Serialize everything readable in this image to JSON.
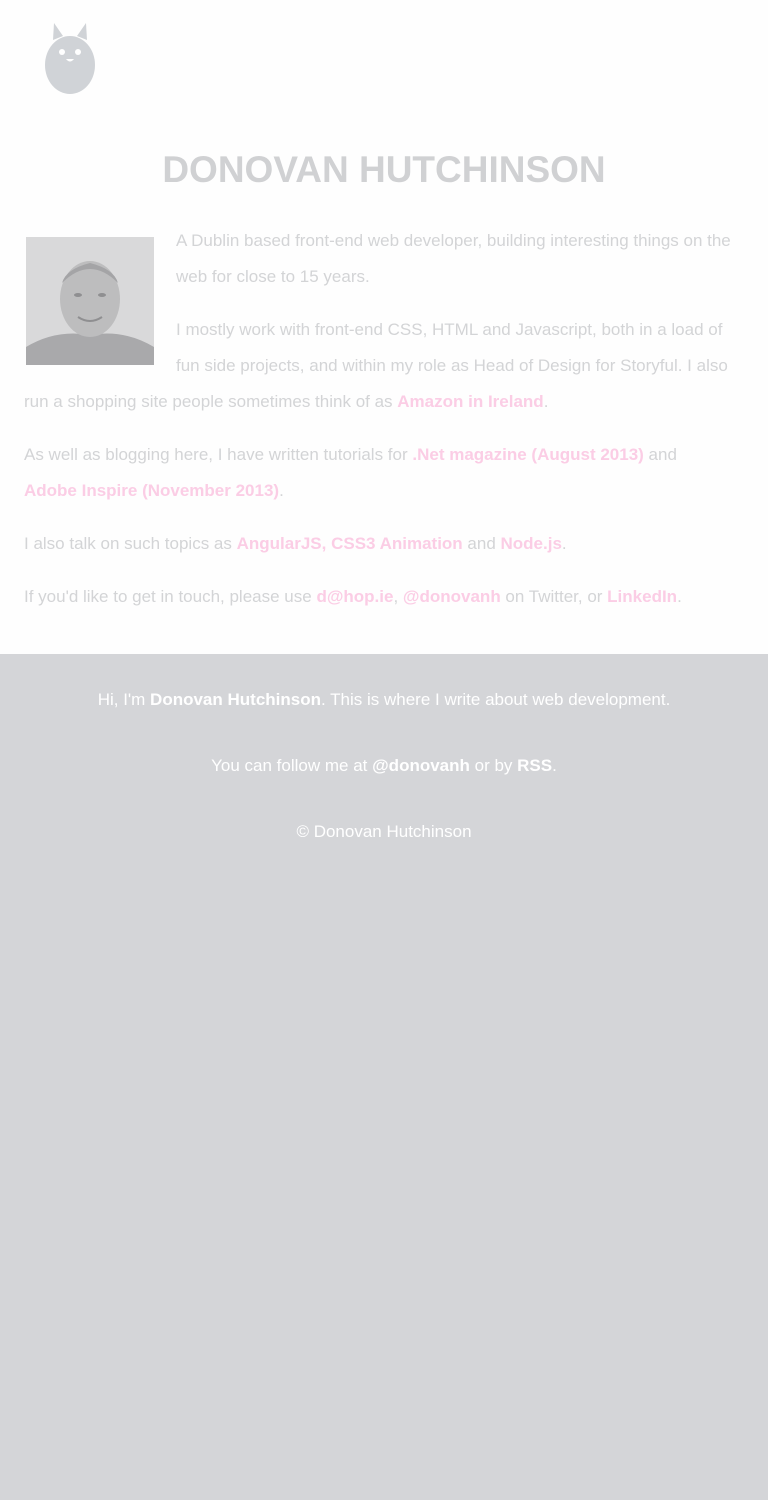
{
  "header": {
    "logo_icon": "rabbit-logo-icon",
    "title": "DONOVAN HUTCHINSON"
  },
  "intro": {
    "p1": "A Dublin based front-end web developer, building interesting things on the web for close to 15 years.",
    "p2_text": "I mostly work with front-end CSS, HTML and Javascript, both in a load of fun side projects, and within my role as Head of Design for Storyful. I also run a shopping site people sometimes think of as ",
    "p2_link": "Amazon in Ireland",
    "p2_end": ".",
    "p3_text": "As well as blogging here, I have written tutorials for ",
    "p3_link1": ".Net magazine (August 2013)",
    "p3_and": " and ",
    "p3_link2": "Adobe Inspire (November 2013)",
    "p3_end": ".",
    "p4_text": "I also talk on such topics as ",
    "p4_link1": "AngularJS, CSS3 Animation",
    "p4_and": " and ",
    "p4_link2": "Node.js",
    "p4_end": ".",
    "p5_text": "If you'd like to get in touch, please use ",
    "p5_link1": "d@hop.ie",
    "p5_comma": ", ",
    "p5_link2": "@donovanh",
    "p5_mid": " on Twitter, or ",
    "p5_link3": "LinkedIn",
    "p5_end": "."
  },
  "footer": {
    "line1_pre": "Hi, I'm ",
    "line1_link": "Donovan Hutchinson",
    "line1_post": ". This is where I write about web development.",
    "line2_pre": "You can follow me at ",
    "line2_link1": "@donovanh",
    "line2_mid": " or by ",
    "line2_link2": "RSS",
    "line2_post": ".",
    "copyright": "© Donovan Hutchinson"
  },
  "colors": {
    "link": "#fbcde5",
    "body_text": "#d3d4d6",
    "footer_bg": "#d4d5d8"
  }
}
